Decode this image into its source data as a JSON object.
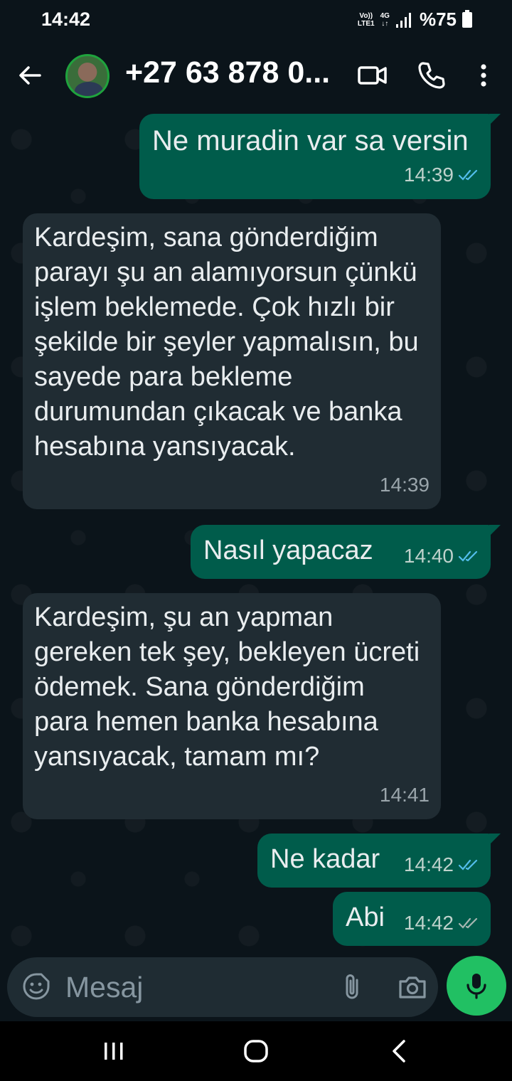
{
  "status_bar": {
    "time": "14:42",
    "volte": "Vo))",
    "lte": "LTE1",
    "network": "4G",
    "battery": "%75"
  },
  "header": {
    "contact_name": "+27 63 878 0...",
    "icons": [
      "back-arrow-icon",
      "video-call-icon",
      "phone-icon",
      "more-vert-icon"
    ]
  },
  "messages": [
    {
      "direction": "out",
      "text": "Ne muradin var sa versin",
      "time": "14:39",
      "status": "read"
    },
    {
      "direction": "in",
      "text": "Kardeşim, sana gönderdiğim parayı şu an alamıyorsun çünkü işlem beklemede. Çok hızlı bir şekilde bir şeyler yapmalısın, bu sayede para bekleme durumundan çıkacak ve banka hesabına yansıyacak.",
      "time": "14:39"
    },
    {
      "direction": "out",
      "text": "Nasıl yapacaz",
      "time": "14:40",
      "status": "read"
    },
    {
      "direction": "in",
      "text": "Kardeşim, şu an yapman gereken tek şey, bekleyen ücreti ödemek. Sana gönderdiğim para hemen banka hesabına yansıyacak, tamam mı?",
      "time": "14:41"
    },
    {
      "direction": "out",
      "text": "Ne kadar",
      "time": "14:42",
      "status": "read"
    },
    {
      "direction": "out",
      "text": "Abi",
      "time": "14:42",
      "status": "delivered"
    }
  ],
  "composer": {
    "placeholder": "Mesaj"
  },
  "colors": {
    "background": "#0b141a",
    "outgoing_bubble": "#005c4b",
    "incoming_bubble": "#202c33",
    "read_tick": "#53bdeb",
    "mic_button": "#21c063"
  }
}
